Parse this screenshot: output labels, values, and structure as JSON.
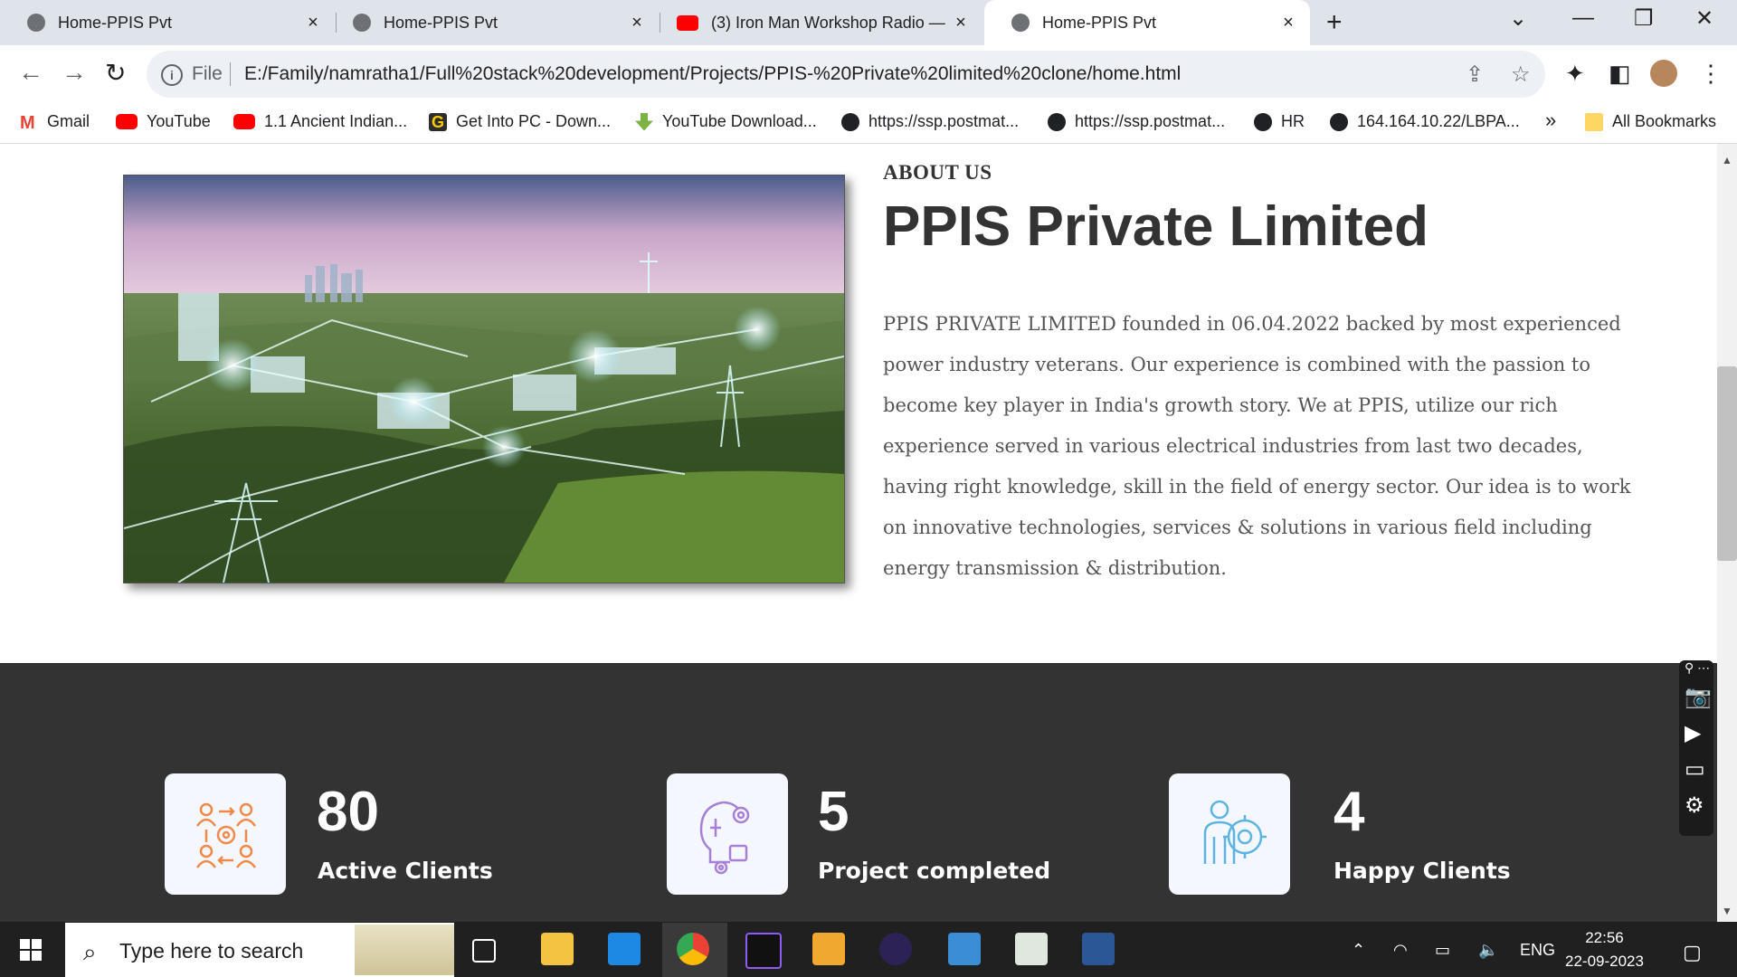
{
  "browser": {
    "tabs": [
      {
        "title": "Home-PPIS Pvt",
        "icon": "globe-icon",
        "active": false
      },
      {
        "title": "Home-PPIS Pvt",
        "icon": "globe-icon",
        "active": false
      },
      {
        "title": "(3) Iron Man Workshop Radio —",
        "icon": "youtube-icon",
        "active": false
      },
      {
        "title": "Home-PPIS Pvt",
        "icon": "globe-icon",
        "active": true
      }
    ],
    "close_glyph": "×",
    "new_tab_glyph": "+",
    "address": {
      "scheme_label": "File",
      "url": "E:/Family/namratha1/Full%20stack%20development/Projects/PPIS-%20Private%20limited%20clone/home.html"
    },
    "bookmarks": [
      {
        "label": "Gmail",
        "icon": "gmail-icon"
      },
      {
        "label": "YouTube",
        "icon": "youtube-icon"
      },
      {
        "label": "1.1 Ancient Indian...",
        "icon": "youtube-icon"
      },
      {
        "label": "Get Into PC - Down...",
        "icon": "getintopc-icon"
      },
      {
        "label": "YouTube Download...",
        "icon": "download-icon"
      },
      {
        "label": "https://ssp.postmat...",
        "icon": "globe-icon"
      },
      {
        "label": "https://ssp.postmat...",
        "icon": "globe-icon"
      },
      {
        "label": "HR",
        "icon": "globe-icon"
      },
      {
        "label": "164.164.10.22/LBPA...",
        "icon": "globe-icon"
      }
    ],
    "bookmarks_overflow": "»",
    "all_bookmarks": "All Bookmarks"
  },
  "about": {
    "kicker": "ABOUT US",
    "title": "PPIS Private Limited",
    "body": "PPIS PRIVATE LIMITED founded in 06.04.2022 backed by most experienced power industry veterans. Our experience is combined with the passion to become key player in India's growth story. We at PPIS, utilize our rich experience served in various electrical industries from last two decades, having right knowledge, skill in the field of energy sector. Our idea is to work on innovative technologies, services & solutions in various field including energy transmission & distribution."
  },
  "stats": [
    {
      "value": "80",
      "label": "Active Clients",
      "icon": "client-network-icon",
      "color": "#f08a4b"
    },
    {
      "value": "5",
      "label": "Project completed",
      "icon": "idea-gear-icon",
      "color": "#a77fd6"
    },
    {
      "value": "4",
      "label": "Happy Clients",
      "icon": "person-gear-icon",
      "color": "#5bb5e0"
    }
  ],
  "taskbar": {
    "search_placeholder": "Type here to search",
    "language": "ENG",
    "time": "22:56",
    "date": "22-09-2023"
  }
}
